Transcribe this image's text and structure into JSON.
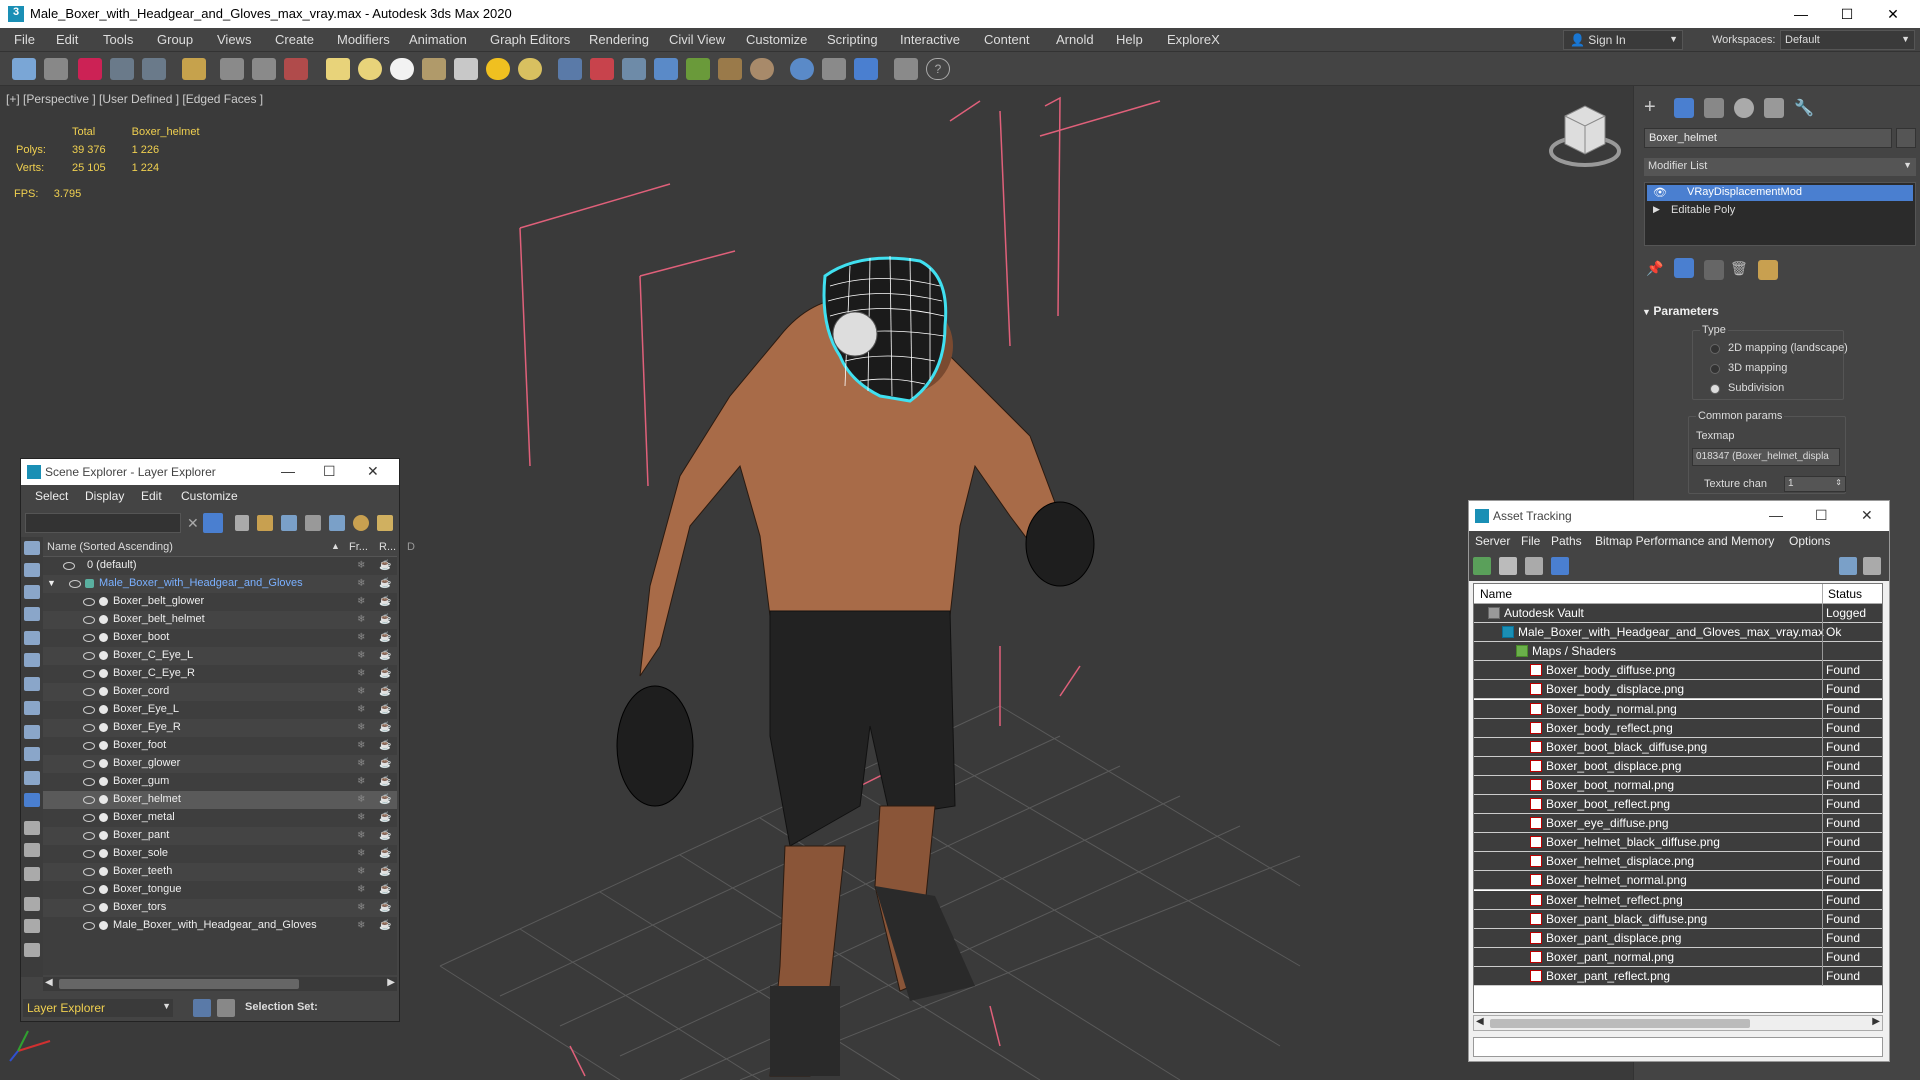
{
  "window": {
    "title": "Male_Boxer_with_Headgear_and_Gloves_max_vray.max - Autodesk 3ds Max 2020",
    "minimize": "—",
    "maximize": "☐",
    "close": "✕"
  },
  "menu": [
    "File",
    "Edit",
    "Tools",
    "Group",
    "Views",
    "Create",
    "Modifiers",
    "Animation",
    "Graph Editors",
    "Rendering",
    "Civil View",
    "Customize",
    "Scripting",
    "Interactive",
    "Content",
    "Arnold",
    "Help",
    "ExploreX"
  ],
  "signin": {
    "label": "Sign In"
  },
  "workspaces": {
    "label": "Workspaces:",
    "value": "Default"
  },
  "viewport": {
    "label": "[+] [Perspective ] [User Defined ] [Edged Faces ]",
    "stats": {
      "col_total": "Total",
      "col_object": "Boxer_helmet",
      "polys_label": "Polys:",
      "polys_total": "39 376",
      "polys_object": "1 226",
      "verts_label": "Verts:",
      "verts_total": "25 105",
      "verts_object": "1 224",
      "fps_label": "FPS:",
      "fps_value": "3.795"
    }
  },
  "command_panel": {
    "object_name": "Boxer_helmet",
    "modifier_list": "Modifier List",
    "stack": [
      "VRayDisplacementMod",
      "Editable Poly"
    ],
    "parameters_title": "Parameters",
    "type_label": "Type",
    "type_options": [
      "2D mapping (landscape)",
      "3D mapping",
      "Subdivision"
    ],
    "common_params": "Common params",
    "texmap_label": "Texmap",
    "texmap_value": "018347 (Boxer_helmet_displa",
    "texture_chan_label": "Texture chan",
    "texture_chan_value": "1"
  },
  "scene_explorer": {
    "title": "Scene Explorer - Layer Explorer",
    "menu": [
      "Select",
      "Display",
      "Edit",
      "Customize"
    ],
    "col_name": "Name (Sorted Ascending)",
    "col_frozen": "Fr...",
    "col_render": "R...",
    "col_d": "D",
    "rows": [
      {
        "name": "0 (default)",
        "indent": 0
      },
      {
        "name": "Male_Boxer_with_Headgear_and_Gloves",
        "indent": 1
      },
      {
        "name": "Boxer_belt_glower",
        "indent": 2
      },
      {
        "name": "Boxer_belt_helmet",
        "indent": 2
      },
      {
        "name": "Boxer_boot",
        "indent": 2
      },
      {
        "name": "Boxer_C_Eye_L",
        "indent": 2
      },
      {
        "name": "Boxer_C_Eye_R",
        "indent": 2
      },
      {
        "name": "Boxer_cord",
        "indent": 2
      },
      {
        "name": "Boxer_Eye_L",
        "indent": 2
      },
      {
        "name": "Boxer_Eye_R",
        "indent": 2
      },
      {
        "name": "Boxer_foot",
        "indent": 2
      },
      {
        "name": "Boxer_glower",
        "indent": 2
      },
      {
        "name": "Boxer_gum",
        "indent": 2
      },
      {
        "name": "Boxer_helmet",
        "indent": 2
      },
      {
        "name": "Boxer_metal",
        "indent": 2
      },
      {
        "name": "Boxer_pant",
        "indent": 2
      },
      {
        "name": "Boxer_sole",
        "indent": 2
      },
      {
        "name": "Boxer_teeth",
        "indent": 2
      },
      {
        "name": "Boxer_tongue",
        "indent": 2
      },
      {
        "name": "Boxer_tors",
        "indent": 2
      },
      {
        "name": "Male_Boxer_with_Headgear_and_Gloves",
        "indent": 2
      }
    ],
    "footer_layer": "Layer Explorer",
    "footer_selection": "Selection Set:"
  },
  "asset_tracking": {
    "title": "Asset Tracking",
    "menu": [
      "Server",
      "File",
      "Paths",
      "Bitmap Performance and Memory",
      "Options"
    ],
    "col_name": "Name",
    "col_status": "Status",
    "rows": [
      {
        "name": "Autodesk Vault",
        "status": "Logged Ou",
        "kind": "vault"
      },
      {
        "name": "Male_Boxer_with_Headgear_and_Gloves_max_vray.max",
        "status": "Ok",
        "kind": "max"
      },
      {
        "name": "Maps / Shaders",
        "status": "",
        "kind": "folder"
      },
      {
        "name": "Boxer_body_diffuse.png",
        "status": "Found",
        "kind": "png"
      },
      {
        "name": "Boxer_body_displace.png",
        "status": "Found",
        "kind": "png"
      },
      {
        "name": "Boxer_body_normal.png",
        "status": "Found",
        "kind": "png"
      },
      {
        "name": "Boxer_body_reflect.png",
        "status": "Found",
        "kind": "png"
      },
      {
        "name": "Boxer_boot_black_diffuse.png",
        "status": "Found",
        "kind": "png"
      },
      {
        "name": "Boxer_boot_displace.png",
        "status": "Found",
        "kind": "png"
      },
      {
        "name": "Boxer_boot_normal.png",
        "status": "Found",
        "kind": "png"
      },
      {
        "name": "Boxer_boot_reflect.png",
        "status": "Found",
        "kind": "png"
      },
      {
        "name": "Boxer_eye_diffuse.png",
        "status": "Found",
        "kind": "png"
      },
      {
        "name": "Boxer_helmet_black_diffuse.png",
        "status": "Found",
        "kind": "png"
      },
      {
        "name": "Boxer_helmet_displace.png",
        "status": "Found",
        "kind": "png"
      },
      {
        "name": "Boxer_helmet_normal.png",
        "status": "Found",
        "kind": "png"
      },
      {
        "name": "Boxer_helmet_reflect.png",
        "status": "Found",
        "kind": "png"
      },
      {
        "name": "Boxer_pant_black_diffuse.png",
        "status": "Found",
        "kind": "png"
      },
      {
        "name": "Boxer_pant_displace.png",
        "status": "Found",
        "kind": "png"
      },
      {
        "name": "Boxer_pant_normal.png",
        "status": "Found",
        "kind": "png"
      },
      {
        "name": "Boxer_pant_reflect.png",
        "status": "Found",
        "kind": "png"
      }
    ]
  },
  "colors": {
    "stats_text": "#f0d050",
    "selection_blue": "#4a7fd0",
    "bbox_pink": "#e0607a",
    "helmet_cyan": "#40e0f0"
  }
}
